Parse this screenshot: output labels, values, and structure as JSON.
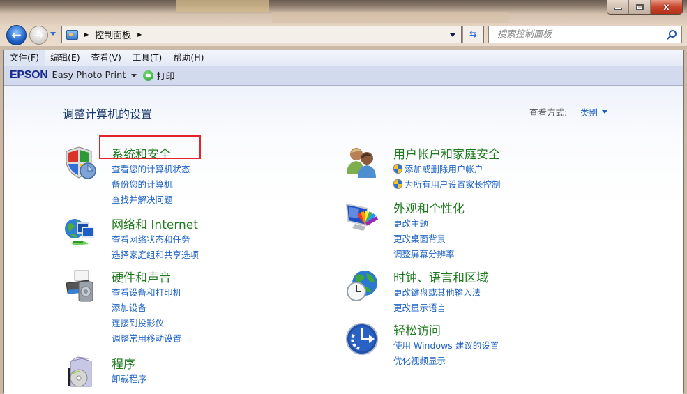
{
  "window": {
    "controls": {
      "minimize": "minimize",
      "maximize": "maximize",
      "close": "x"
    }
  },
  "nav": {
    "back_glyph": "←",
    "forward_glyph": "→",
    "address": {
      "crumbs": [
        "控制面板"
      ],
      "separator": "▶"
    },
    "refresh_glyph": "⇆",
    "search": {
      "placeholder": "搜索控制面板",
      "value": ""
    }
  },
  "menubar": {
    "items": [
      {
        "label": "文件(F)"
      },
      {
        "label": "编辑(E)"
      },
      {
        "label": "查看(V)"
      },
      {
        "label": "工具(T)"
      },
      {
        "label": "帮助(H)"
      }
    ]
  },
  "toolbar": {
    "brand": "EPSON",
    "app_label": "Easy Photo Print",
    "print_label": "打印"
  },
  "main": {
    "title": "调整计算机的设置",
    "view_by_label": "查看方式:",
    "view_by_value": "类别",
    "highlight_color": "#e3232a",
    "title_color": "#1f7a1f",
    "link_color": "#1e63c4",
    "categories_left": [
      {
        "icon": "shield-icon",
        "title": "系统和安全",
        "links": [
          "查看您的计算机状态",
          "备份您的计算机",
          "查找并解决问题"
        ],
        "highlighted": true
      },
      {
        "icon": "network-icon",
        "title": "网络和 Internet",
        "links": [
          "查看网络状态和任务",
          "选择家庭组和共享选项"
        ]
      },
      {
        "icon": "hardware-icon",
        "title": "硬件和声音",
        "links": [
          "查看设备和打印机",
          "添加设备",
          "连接到投影仪",
          "调整常用移动设置"
        ]
      },
      {
        "icon": "programs-icon",
        "title": "程序",
        "links": [
          "卸载程序"
        ]
      }
    ],
    "categories_right": [
      {
        "icon": "users-icon",
        "title": "用户帐户和家庭安全",
        "links": [
          "添加或删除用户帐户",
          "为所有用户设置家长控制"
        ],
        "uac_links": true
      },
      {
        "icon": "appearance-icon",
        "title": "外观和个性化",
        "links": [
          "更改主题",
          "更改桌面背景",
          "调整屏幕分辨率"
        ]
      },
      {
        "icon": "clock-globe-icon",
        "title": "时钟、语言和区域",
        "links": [
          "更改键盘或其他输入法",
          "更改显示语言"
        ]
      },
      {
        "icon": "ease-of-access-icon",
        "title": "轻松访问",
        "links": [
          "使用 Windows 建议的设置",
          "优化视频显示"
        ]
      }
    ]
  }
}
